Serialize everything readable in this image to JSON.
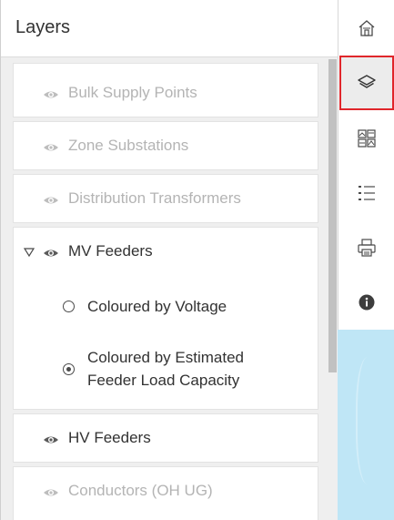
{
  "panel": {
    "title": "Layers"
  },
  "layers": [
    {
      "label": "Bulk Supply Points",
      "visible": false,
      "icon": "eye-icon"
    },
    {
      "label": "Zone Substations",
      "visible": false,
      "icon": "eye-icon"
    },
    {
      "label": "Distribution Transformers",
      "visible": false,
      "icon": "eye-icon"
    },
    {
      "label": "MV Feeders",
      "visible": true,
      "expanded": true,
      "icon": "eye-icon",
      "options": [
        {
          "label": "Coloured by Voltage",
          "selected": false
        },
        {
          "label_line1": "Coloured by Estimated",
          "label_line2": "Feeder Load Capacity",
          "selected": true
        }
      ]
    },
    {
      "label": "HV Feeders",
      "visible": true,
      "icon": "eye-icon"
    },
    {
      "label": "Conductors (OH UG)",
      "visible": false,
      "icon": "eye-icon"
    }
  ],
  "toolbar": {
    "items": [
      {
        "name": "home",
        "icon": "home-icon",
        "active": false
      },
      {
        "name": "layers",
        "icon": "layers-icon",
        "active": true
      },
      {
        "name": "basemap-gallery",
        "icon": "basemap-gallery-icon",
        "active": false
      },
      {
        "name": "legend",
        "icon": "legend-list-icon",
        "active": false
      },
      {
        "name": "print",
        "icon": "print-icon",
        "active": false
      },
      {
        "name": "info",
        "icon": "info-icon",
        "active": false
      }
    ]
  },
  "colors": {
    "active_border": "#e0262b",
    "text_dark": "#323232",
    "text_dim": "#b4b4b4",
    "map_water": "#bfe6f6"
  }
}
